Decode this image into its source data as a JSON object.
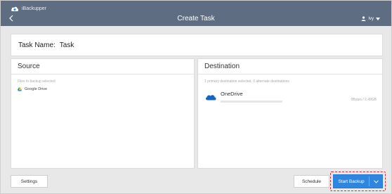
{
  "app": {
    "brand_name": "iBackupper",
    "window_title": "Create Task",
    "user_name": "Ivy"
  },
  "task": {
    "label": "Task Name:",
    "value": "Task"
  },
  "source": {
    "title": "Source",
    "subtitle": "Files to backup selected",
    "items": [
      {
        "name": "Google Drive",
        "icon": "google-drive-icon"
      }
    ]
  },
  "destination": {
    "title": "Destination",
    "subtitle": "1 primary destination selected, 0 alternate destinations",
    "items": [
      {
        "name": "OneDrive",
        "icon": "onedrive-icon",
        "size": "0Bytes / 2.49GB",
        "used_fraction": 0
      }
    ]
  },
  "buttons": {
    "settings": "Settings",
    "schedule": "Schedule",
    "start": "Start Backup"
  },
  "colors": {
    "titlebar": "#5f6d82",
    "primary": "#2f86e0",
    "highlight": "#d1283a",
    "background": "#e8e8e8"
  }
}
